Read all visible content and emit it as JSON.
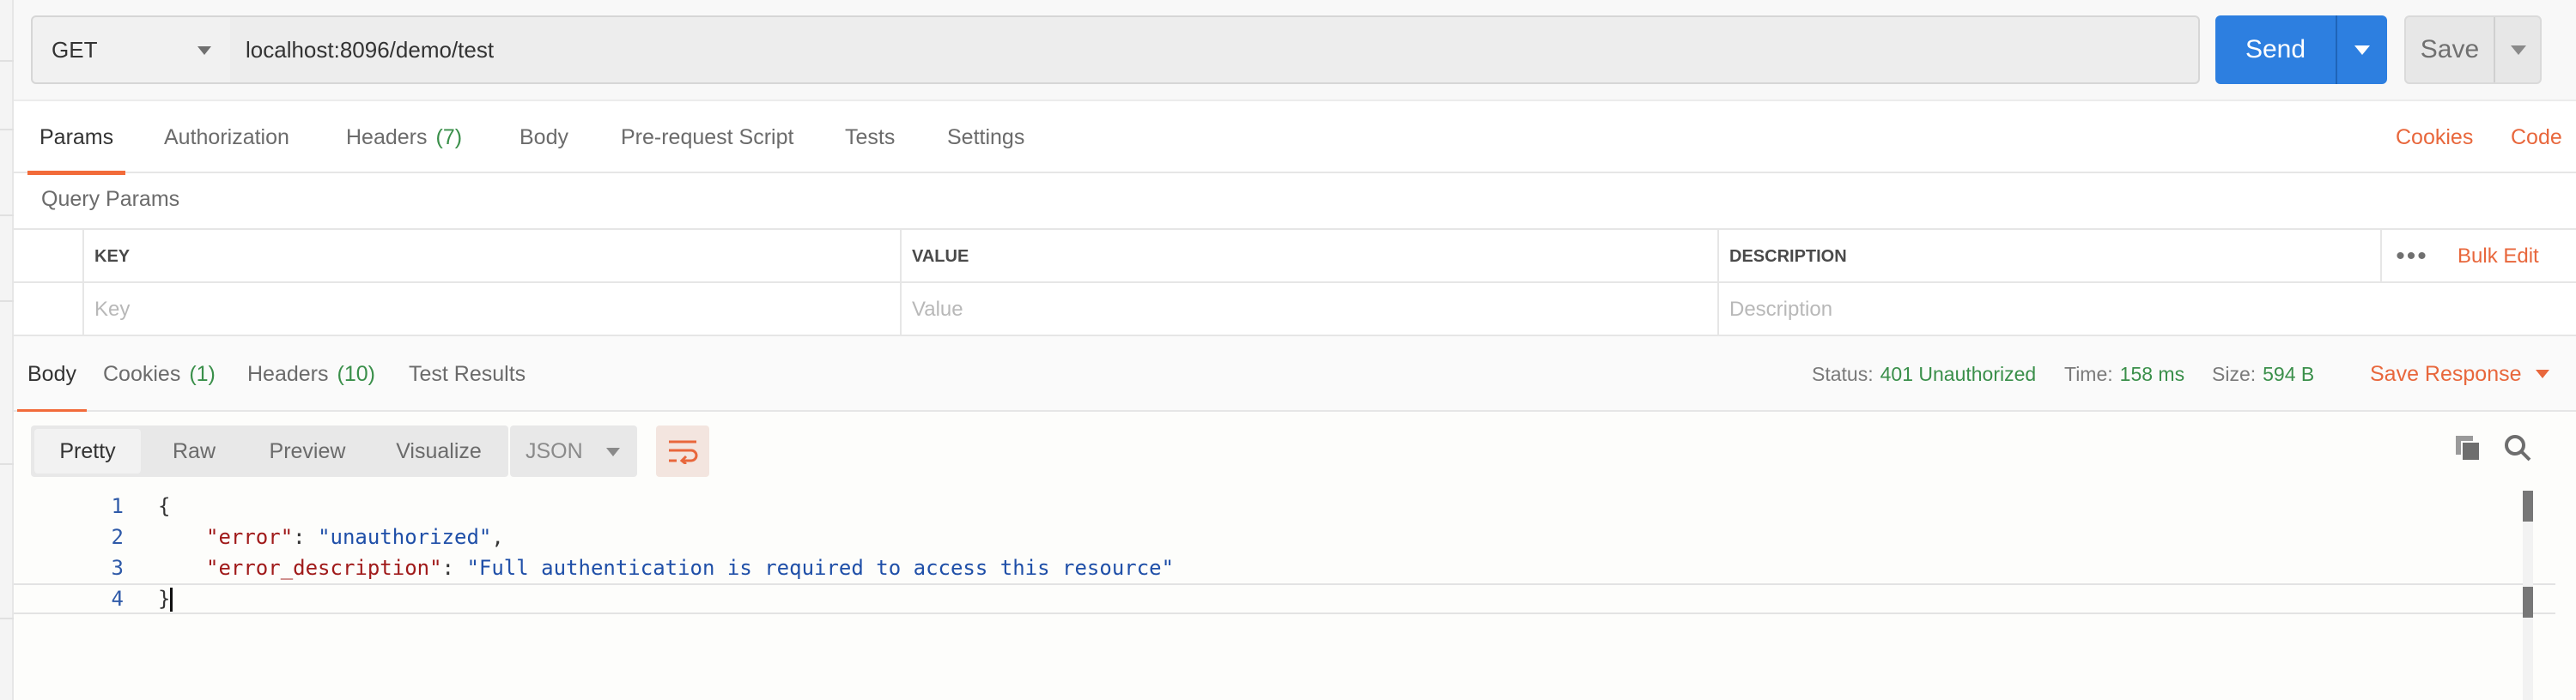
{
  "request": {
    "method": "GET",
    "url": "localhost:8096/demo/test",
    "send_label": "Send",
    "save_label": "Save"
  },
  "request_tabs": [
    {
      "label": "Params",
      "count": "",
      "active": true
    },
    {
      "label": "Authorization",
      "count": "",
      "active": false
    },
    {
      "label": "Headers",
      "count": "(7)",
      "active": false
    },
    {
      "label": "Body",
      "count": "",
      "active": false
    },
    {
      "label": "Pre-request Script",
      "count": "",
      "active": false
    },
    {
      "label": "Tests",
      "count": "",
      "active": false
    },
    {
      "label": "Settings",
      "count": "",
      "active": false
    }
  ],
  "request_links": {
    "cookies": "Cookies",
    "code": "Code"
  },
  "query_params": {
    "title": "Query Params",
    "headers": [
      "KEY",
      "VALUE",
      "DESCRIPTION"
    ],
    "placeholders": [
      "Key",
      "Value",
      "Description"
    ],
    "more_label": "•••",
    "bulk_edit": "Bulk Edit"
  },
  "response_tabs": [
    {
      "label": "Body",
      "count": "",
      "active": true
    },
    {
      "label": "Cookies",
      "count": "(1)",
      "active": false
    },
    {
      "label": "Headers",
      "count": "(10)",
      "active": false
    },
    {
      "label": "Test Results",
      "count": "",
      "active": false
    }
  ],
  "response_status": {
    "status_label": "Status:",
    "status_value": "401 Unauthorized",
    "time_label": "Time:",
    "time_value": "158 ms",
    "size_label": "Size:",
    "size_value": "594 B",
    "save_response": "Save Response"
  },
  "body_view": {
    "modes": [
      "Pretty",
      "Raw",
      "Preview",
      "Visualize"
    ],
    "active_mode": "Pretty",
    "language": "JSON"
  },
  "code_lines": [
    {
      "num": "1",
      "text": "{"
    },
    {
      "num": "2",
      "key": "\"error\"",
      "value": "\"unauthorized\"",
      "suffix": ","
    },
    {
      "num": "3",
      "key": "\"error_description\"",
      "value": "\"Full authentication is required to access this resource\"",
      "suffix": ""
    },
    {
      "num": "4",
      "text": "}"
    }
  ],
  "colors": {
    "accent_orange": "#f26b3a",
    "send_blue": "#2d7fe0",
    "status_green": "#3a8f4a"
  },
  "icons": [
    "chevron-down-icon",
    "more-dots-icon",
    "wrap-lines-icon",
    "copy-icon",
    "search-icon"
  ]
}
